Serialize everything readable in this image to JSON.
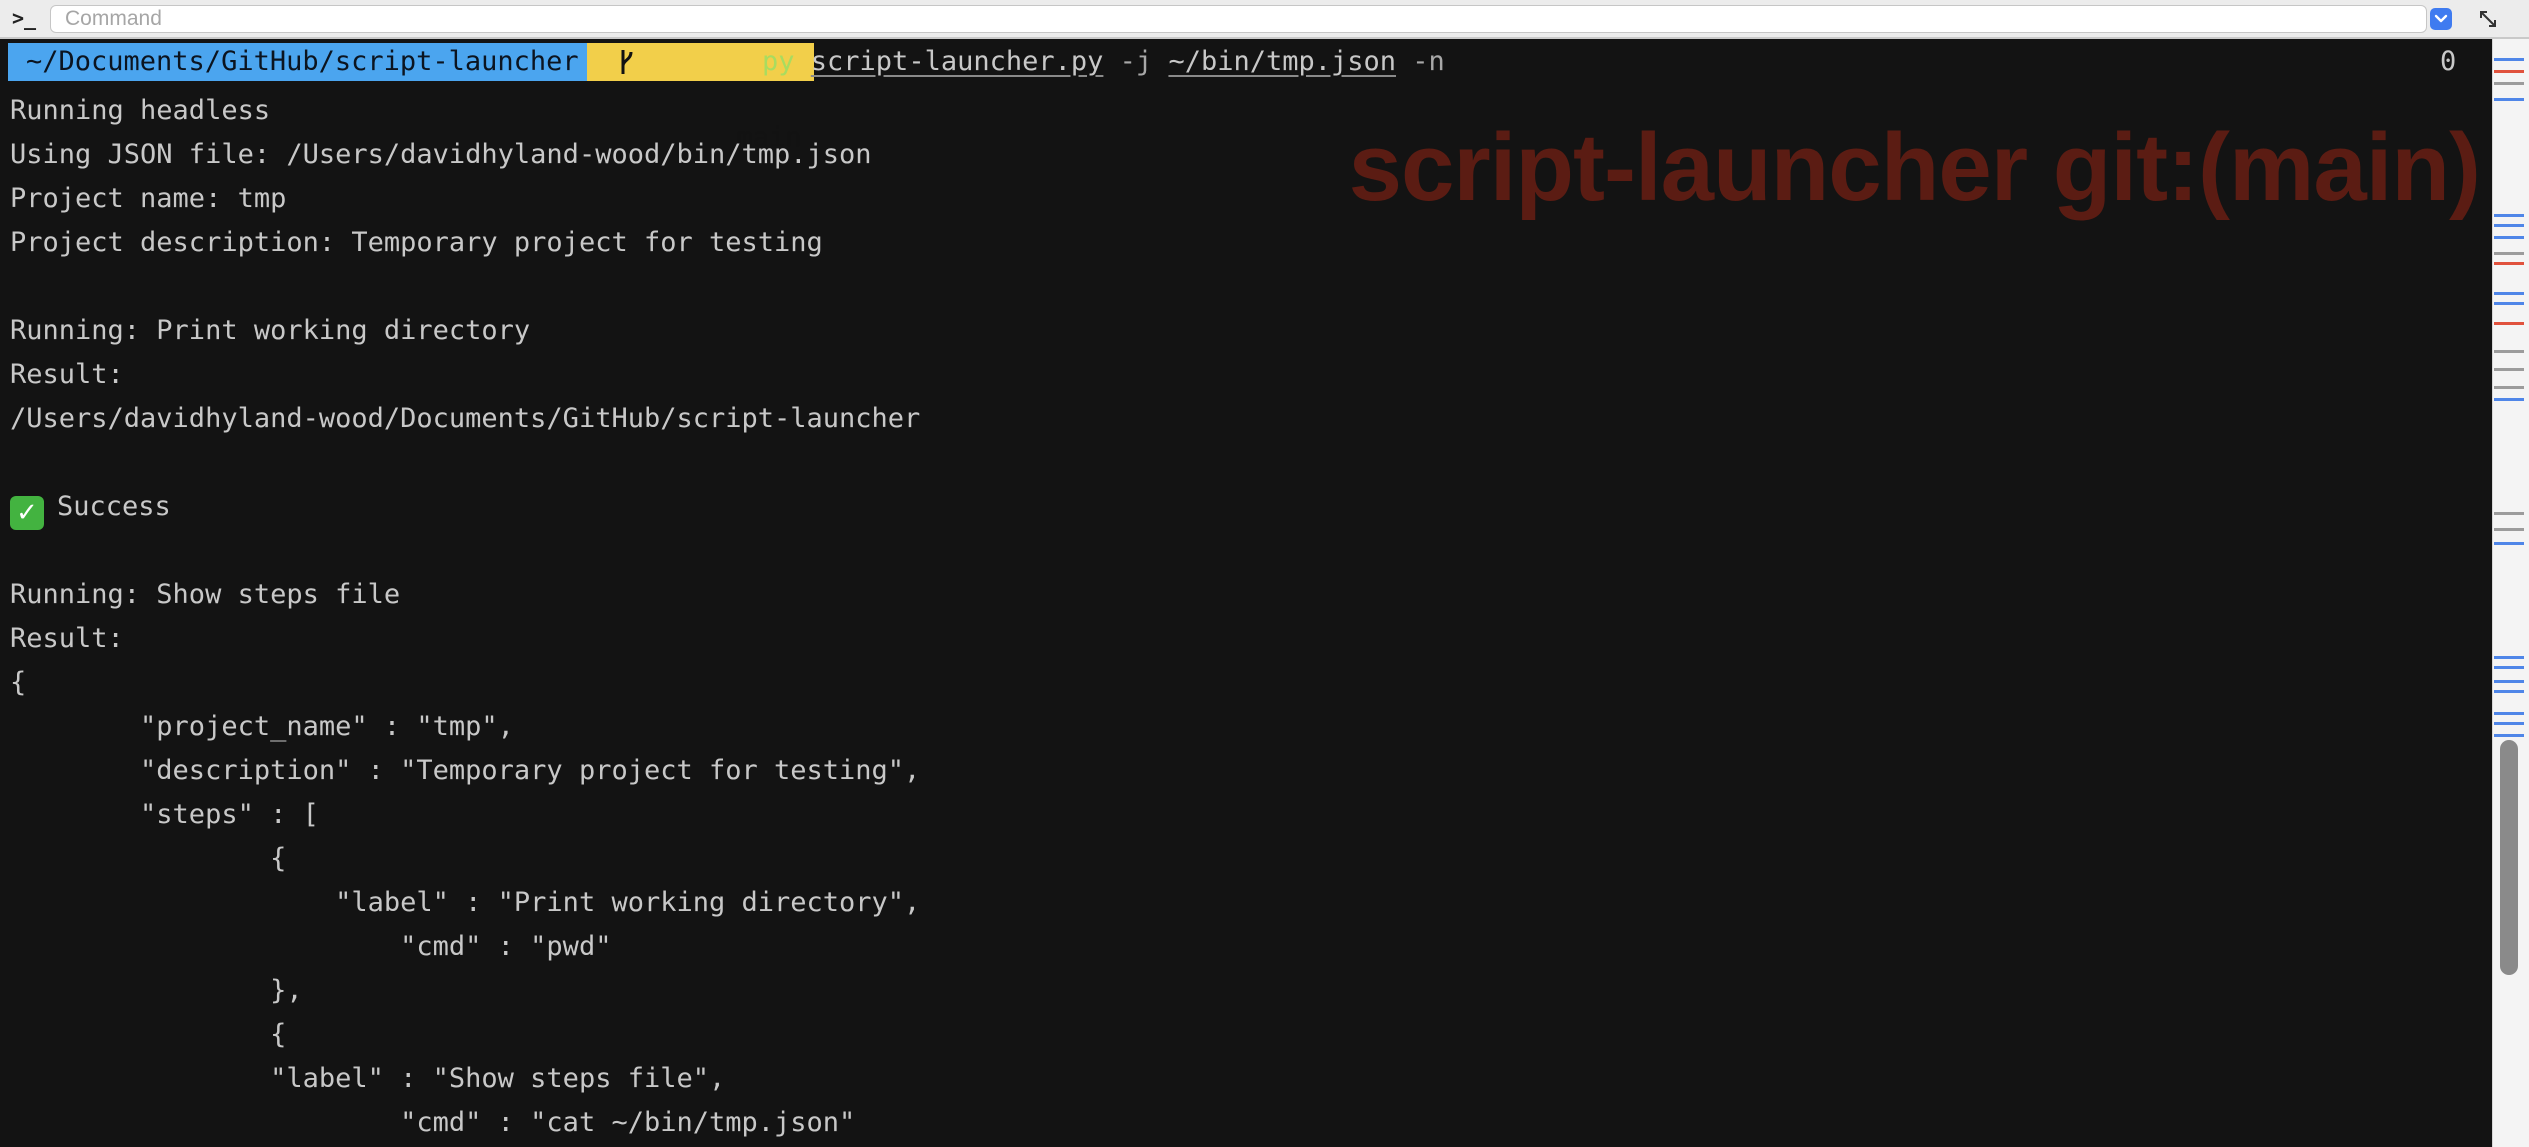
{
  "command_bar": {
    "prompt_icon": ">_",
    "placeholder": "Command",
    "dropdown_icon": "chevron-down-icon",
    "expand_icon": "expand-arrows-icon"
  },
  "prompt": {
    "cwd": "~/Documents/GitHub/script-launcher",
    "branch_icon": "git-branch-icon",
    "branch": "main",
    "command_program": "py",
    "command_script": "script-launcher.py",
    "flag_j": "-j",
    "json_path": "~/bin/tmp.json",
    "flag_n": "-n",
    "exit_code": "0"
  },
  "badge": "script-launcher git:(main)",
  "output": {
    "l1": "Running headless",
    "l2": "Using JSON file: /Users/davidhyland-wood/bin/tmp.json",
    "l3": "Project name: tmp",
    "l4": "Project description: Temporary project for testing",
    "l5": "Running: Print working directory",
    "l6": "Result:",
    "l7": "/Users/davidhyland-wood/Documents/GitHub/script-launcher",
    "l8_icon": "checkmark-icon",
    "l8": "Success",
    "l9": "Running: Show steps file",
    "l10": "Result:",
    "l11": "{",
    "l12": "        \"project_name\" : \"tmp\",",
    "l13": "        \"description\" : \"Temporary project for testing\",",
    "l14": "        \"steps\" : [",
    "l15": "                {",
    "l16": "                    \"label\" : \"Print working directory\",",
    "l17": "                        \"cmd\" : \"pwd\"",
    "l18": "                },",
    "l19": "                {",
    "l20": "                \"label\" : \"Show steps file\",",
    "l21": "                        \"cmd\" : \"cat ~/bin/tmp.json\""
  },
  "colors": {
    "terminal_bg": "#131313",
    "cwd_segment": "#4ba5ef",
    "branch_segment": "#f2cf4a",
    "command_green": "#a9dc5f",
    "badge_red": "#5b1c13",
    "mark_blue": "#4f86e8",
    "mark_red": "#e0523d",
    "mark_gray": "#9c9c9c"
  }
}
